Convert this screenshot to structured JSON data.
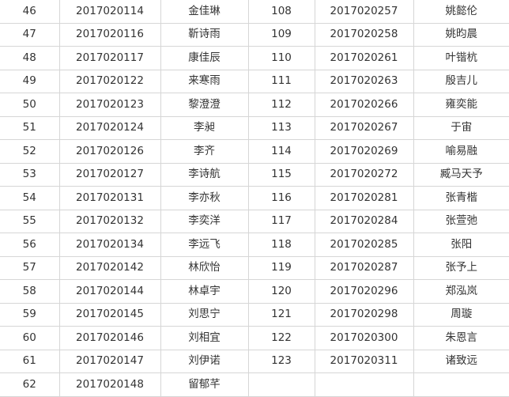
{
  "rows": [
    {
      "left": {
        "no": "46",
        "id": "2017020114",
        "name": "金佳琳"
      },
      "right": {
        "no": "108",
        "id": "2017020257",
        "name": "姚懿伦"
      }
    },
    {
      "left": {
        "no": "47",
        "id": "2017020116",
        "name": "靳诗雨"
      },
      "right": {
        "no": "109",
        "id": "2017020258",
        "name": "姚昀晨"
      }
    },
    {
      "left": {
        "no": "48",
        "id": "2017020117",
        "name": "康佳辰"
      },
      "right": {
        "no": "110",
        "id": "2017020261",
        "name": "叶锴杭"
      }
    },
    {
      "left": {
        "no": "49",
        "id": "2017020122",
        "name": "来寒雨"
      },
      "right": {
        "no": "111",
        "id": "2017020263",
        "name": "殷吉儿"
      }
    },
    {
      "left": {
        "no": "50",
        "id": "2017020123",
        "name": "黎澄澄"
      },
      "right": {
        "no": "112",
        "id": "2017020266",
        "name": "雍奕能"
      }
    },
    {
      "left": {
        "no": "51",
        "id": "2017020124",
        "name": "李昶"
      },
      "right": {
        "no": "113",
        "id": "2017020267",
        "name": "于宙"
      }
    },
    {
      "left": {
        "no": "52",
        "id": "2017020126",
        "name": "李齐"
      },
      "right": {
        "no": "114",
        "id": "2017020269",
        "name": "喻易融"
      }
    },
    {
      "left": {
        "no": "53",
        "id": "2017020127",
        "name": "李诗航"
      },
      "right": {
        "no": "115",
        "id": "2017020272",
        "name": "臧马天予"
      }
    },
    {
      "left": {
        "no": "54",
        "id": "2017020131",
        "name": "李亦秋"
      },
      "right": {
        "no": "116",
        "id": "2017020281",
        "name": "张青楷"
      }
    },
    {
      "left": {
        "no": "55",
        "id": "2017020132",
        "name": "李奕洋"
      },
      "right": {
        "no": "117",
        "id": "2017020284",
        "name": "张萱弛"
      }
    },
    {
      "left": {
        "no": "56",
        "id": "2017020134",
        "name": "李远飞"
      },
      "right": {
        "no": "118",
        "id": "2017020285",
        "name": "张阳"
      }
    },
    {
      "left": {
        "no": "57",
        "id": "2017020142",
        "name": "林欣怡"
      },
      "right": {
        "no": "119",
        "id": "2017020287",
        "name": "张予上"
      }
    },
    {
      "left": {
        "no": "58",
        "id": "2017020144",
        "name": "林卓宇"
      },
      "right": {
        "no": "120",
        "id": "2017020296",
        "name": "郑泓岚"
      }
    },
    {
      "left": {
        "no": "59",
        "id": "2017020145",
        "name": "刘思宁"
      },
      "right": {
        "no": "121",
        "id": "2017020298",
        "name": "周璇"
      }
    },
    {
      "left": {
        "no": "60",
        "id": "2017020146",
        "name": "刘相宜"
      },
      "right": {
        "no": "122",
        "id": "2017020300",
        "name": "朱恩言"
      }
    },
    {
      "left": {
        "no": "61",
        "id": "2017020147",
        "name": "刘伊诺"
      },
      "right": {
        "no": "123",
        "id": "2017020311",
        "name": "诸致远"
      }
    },
    {
      "left": {
        "no": "62",
        "id": "2017020148",
        "name": "留郁芊"
      },
      "right": {
        "no": "",
        "id": "",
        "name": ""
      }
    }
  ]
}
